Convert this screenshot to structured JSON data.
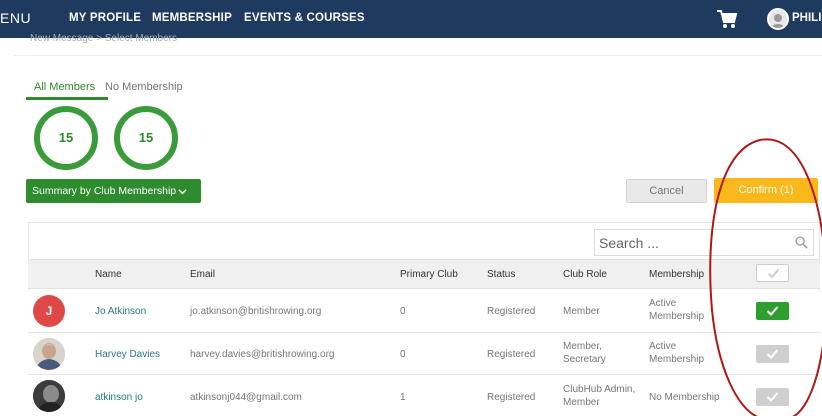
{
  "nav": {
    "menu": "ENU",
    "links": [
      "MY PROFILE",
      "MEMBERSHIP",
      "EVENTS & COURSES"
    ],
    "user": "PHILI",
    "icons": [
      "cart-icon",
      "user-avatar"
    ]
  },
  "breadcrumb": "New Message  >  Select Members",
  "tabs": {
    "all": "All Members",
    "none": "No Membership"
  },
  "counts": [
    {
      "value": "15"
    },
    {
      "value": "15"
    }
  ],
  "summary_button": "Summary by Club Membership",
  "cancel_button": "Cancel",
  "confirm_button": "Confirm (1)",
  "search": {
    "placeholder": "Search ...",
    "value": ""
  },
  "table": {
    "headers": [
      "Name",
      "Email",
      "Primary Club",
      "Status",
      "Club Role",
      "Membership"
    ],
    "rows": [
      {
        "avatar": "J",
        "avatar_color": "#e04848",
        "name": "Jo Atkinson",
        "email": "jo.atkinson@britishrowing.org",
        "primary_club": "0",
        "status": "Registered",
        "role_line1": "Member",
        "role_line2": "",
        "membership_line1": "Active",
        "membership_line2": "Membership",
        "selected": true
      },
      {
        "avatar": "",
        "name": "Harvey Davies",
        "email": "harvey.davies@britishrowing.org",
        "primary_club": "0",
        "status": "Registered",
        "role_line1": "Member,",
        "role_line2": "Secretary",
        "membership_line1": "Active",
        "membership_line2": "Membership",
        "selected": false
      },
      {
        "avatar": "",
        "name": "atkinson jo",
        "email": "atkinsonj044@gmail.com",
        "primary_club": "1",
        "status": "Registered",
        "role_line1": "ClubHub Admin,",
        "role_line2": "Member",
        "membership_line1": "No Membership",
        "membership_line2": "",
        "selected": false
      }
    ]
  },
  "colors": {
    "nav_bg": "#1e3a5f",
    "accent_green": "#2e8b2e",
    "confirm_orange": "#fbb81b",
    "annotation_red": "#b01818"
  }
}
